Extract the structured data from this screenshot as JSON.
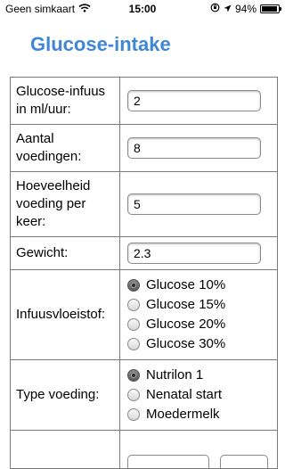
{
  "status": {
    "carrier": "Geen simkaart",
    "time": "15:00",
    "battery_text": "94%",
    "battery_level": 0.94
  },
  "page_title": "Glucose-intake",
  "fields": {
    "infuus": {
      "label": "Glucose-infuus in ml/uur:",
      "value": "2"
    },
    "aantal": {
      "label": "Aantal voedingen:",
      "value": "8"
    },
    "hoeveelheid": {
      "label": "Hoeveelheid voeding per keer:",
      "value": "5"
    },
    "gewicht": {
      "label": "Gewicht:",
      "value": "2.3"
    }
  },
  "infuusvloeistof": {
    "label": "Infuusvloeistof:",
    "options": [
      "Glucose 10%",
      "Glucose 15%",
      "Glucose 20%",
      "Glucose 30%"
    ],
    "selected": "Glucose 10%"
  },
  "type_voeding": {
    "label": "Type voeding:",
    "options": [
      "Nutrilon 1",
      "Nenatal start",
      "Moedermelk"
    ],
    "selected": "Nutrilon 1"
  }
}
